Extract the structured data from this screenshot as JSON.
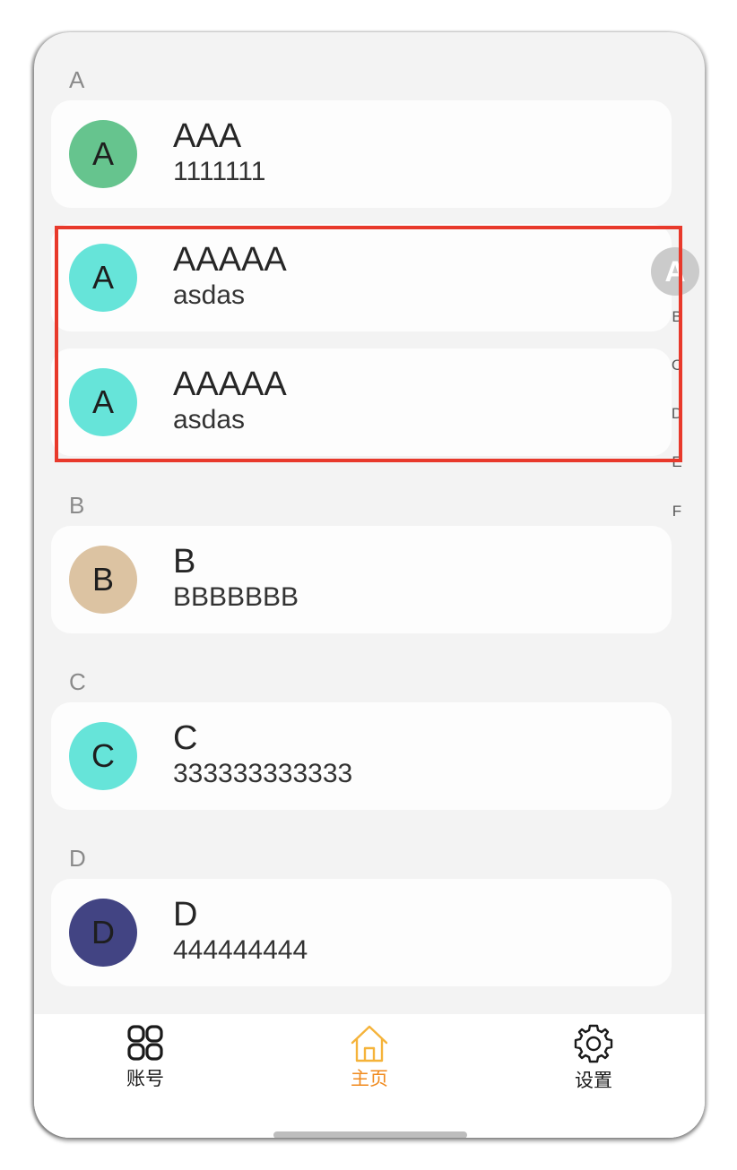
{
  "sections": [
    {
      "header": "A",
      "contacts": [
        {
          "initial": "A",
          "name": "AAA",
          "phone": "1111111",
          "avatar_color": "#66c48e"
        },
        {
          "initial": "A",
          "name": "AAAAA",
          "phone": "asdas",
          "avatar_color": "#66e4d9"
        },
        {
          "initial": "A",
          "name": "AAAAA",
          "phone": "asdas",
          "avatar_color": "#66e4d9"
        }
      ]
    },
    {
      "header": "B",
      "contacts": [
        {
          "initial": "B",
          "name": "B",
          "phone": "BBBBBBB",
          "avatar_color": "#dcc3a2"
        }
      ]
    },
    {
      "header": "C",
      "contacts": [
        {
          "initial": "C",
          "name": "C",
          "phone": "333333333333",
          "avatar_color": "#66e4d9"
        }
      ]
    },
    {
      "header": "D",
      "contacts": [
        {
          "initial": "D",
          "name": "D",
          "phone": "444444444",
          "avatar_color": "#424483"
        }
      ]
    }
  ],
  "index_bar": {
    "selected": "A",
    "letters": [
      "B",
      "C",
      "D",
      "E",
      "F"
    ]
  },
  "tabbar": {
    "account": {
      "label": "账号",
      "icon": "grid-icon",
      "color": "#1a1a1a"
    },
    "home": {
      "label": "主页",
      "icon": "home-icon",
      "color": "#f08a1e",
      "active": true
    },
    "settings": {
      "label": "设置",
      "icon": "gear-icon",
      "color": "#1a1a1a"
    }
  },
  "colors": {
    "highlight_border": "#e8392b",
    "background": "#f3f3f3",
    "card": "#fdfdfd"
  }
}
